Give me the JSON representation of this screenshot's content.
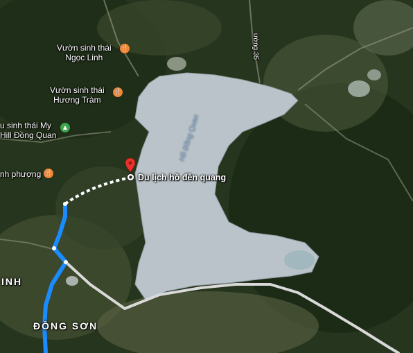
{
  "places": {
    "vuon_ngoc_linh": [
      "Vườn sinh thái",
      "Ngọc Linh"
    ],
    "vuon_huong_tram": [
      "Vườn sinh thái",
      "Hương Tràm"
    ],
    "my_hill": [
      "u sinh thái My",
      "Hill Đồng Quan"
    ],
    "anh_phuong": "nh phượng"
  },
  "destination": {
    "label": "Du lịch hồ đền quang"
  },
  "lake": {
    "name": "Hồ Đồng Quan"
  },
  "road": {
    "name": "ường 35"
  },
  "areas": {
    "inh": "INH",
    "dong_son": "ĐỒNG SƠN"
  },
  "colors": {
    "route": "#1a8cff",
    "walking_route": "#ffffff",
    "road": "#d9d9d9",
    "lake": "#b9c3c9",
    "food_pin": "#f08a3a",
    "park_pin": "#3fa34d",
    "destination_marker": "#e8322b"
  },
  "icons": {
    "food": "fork-knife-icon",
    "park": "mountain-icon",
    "destination": "red-pin-icon"
  }
}
